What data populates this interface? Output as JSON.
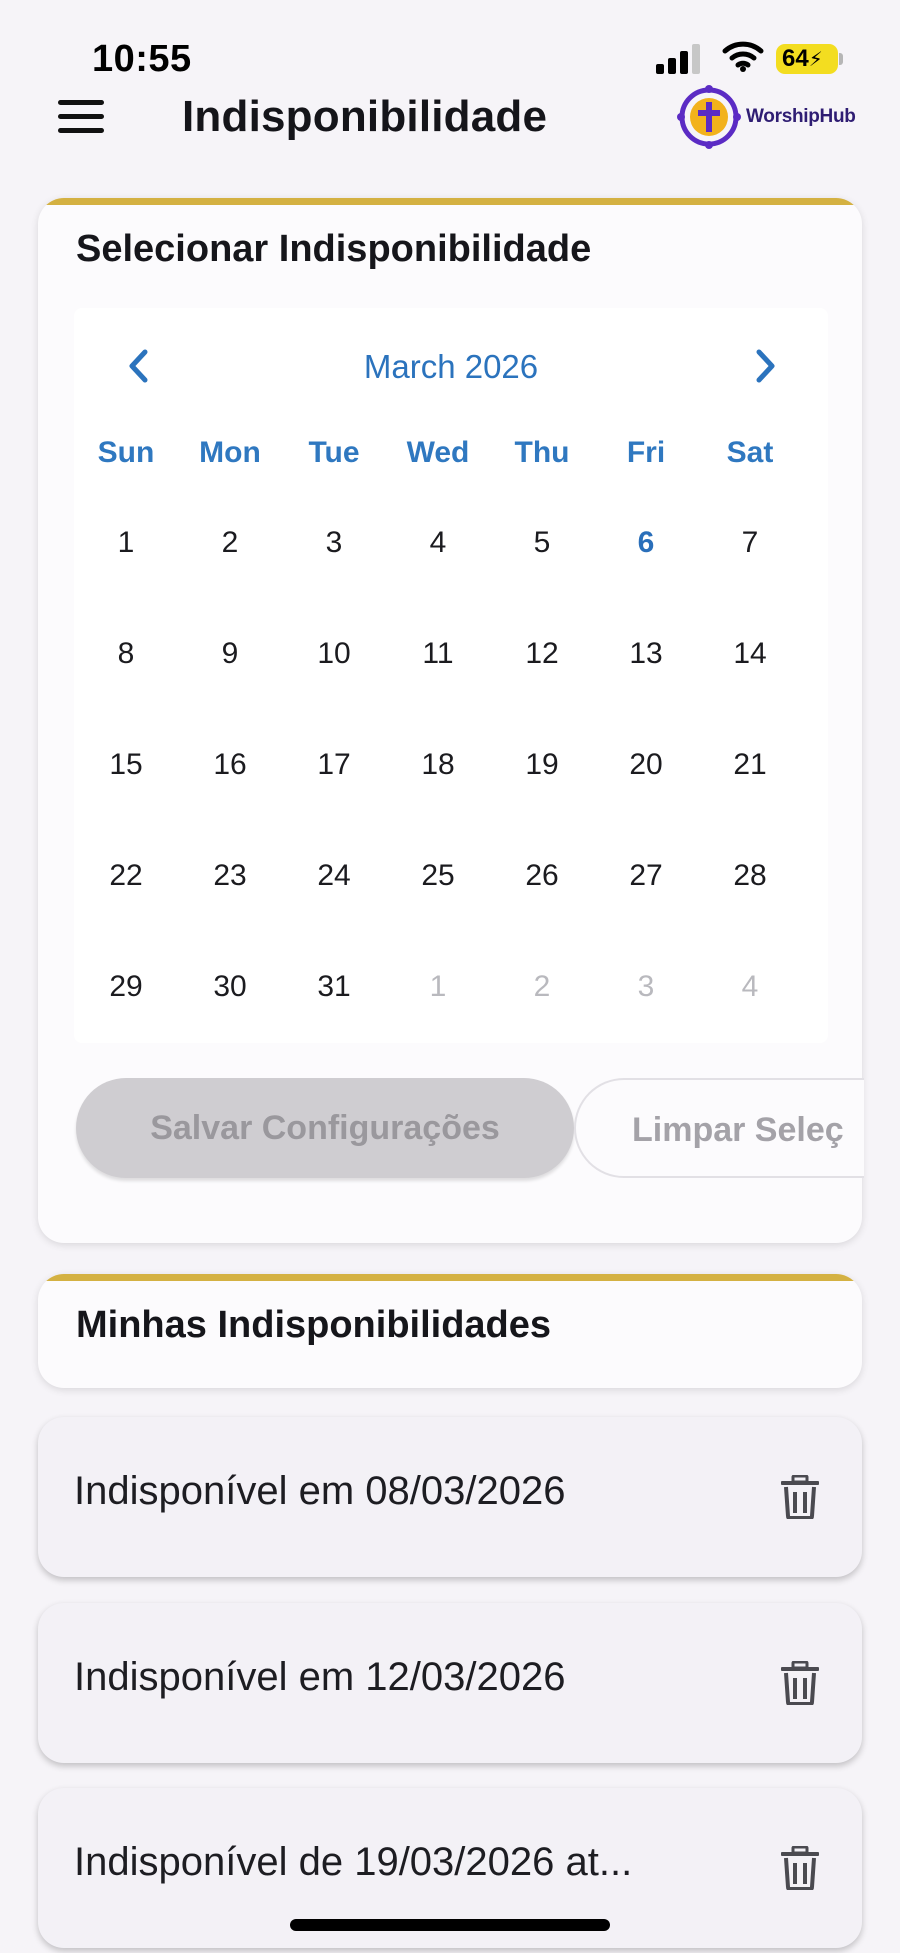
{
  "status_bar": {
    "time": "10:55",
    "battery": "64"
  },
  "header": {
    "title": "Indisponibilidade",
    "logo": {
      "brand": "WorshipHub"
    }
  },
  "calendar_card": {
    "title": "Selecionar Indisponibilidade",
    "calendar": {
      "month_label": "March 2026",
      "weekdays": [
        "Sun",
        "Mon",
        "Tue",
        "Wed",
        "Thu",
        "Fri",
        "Sat"
      ],
      "weeks": [
        [
          "1",
          "2",
          "3",
          "4",
          "5",
          "6",
          "7"
        ],
        [
          "8",
          "9",
          "10",
          "11",
          "12",
          "13",
          "14"
        ],
        [
          "15",
          "16",
          "17",
          "18",
          "19",
          "20",
          "21"
        ],
        [
          "22",
          "23",
          "24",
          "25",
          "26",
          "27",
          "28"
        ],
        [
          "29",
          "30",
          "31",
          "1",
          "2",
          "3",
          "4"
        ]
      ],
      "today": "6"
    },
    "save_label": "Salvar Configurações",
    "clear_label": "Limpar Seleç"
  },
  "my_unavailability": {
    "title": "Minhas Indisponibilidades",
    "items": [
      {
        "label": "Indisponível em 08/03/2026"
      },
      {
        "label": "Indisponível em 12/03/2026"
      },
      {
        "label": "Indisponível de 19/03/2026 at..."
      }
    ]
  },
  "colors": {
    "accent_gold": "#d4b142",
    "calendar_blue": "#2f78c0",
    "button_disabled": "#cfcdd1"
  },
  "icons": [
    "menu-icon",
    "worship-hub-logo",
    "chevron-left-icon",
    "chevron-right-icon",
    "trash-icon",
    "signal-icon",
    "wifi-icon",
    "battery-icon"
  ]
}
